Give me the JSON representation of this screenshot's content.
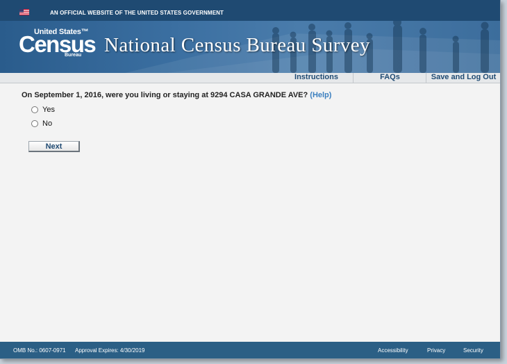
{
  "gov_banner": {
    "text": "AN OFFICIAL WEBSITE OF THE UNITED STATES GOVERNMENT"
  },
  "logo": {
    "line1": "United States™",
    "line2": "Census",
    "line3": "Bureau"
  },
  "site_title": "National Census Bureau Survey",
  "nav": {
    "instructions": "Instructions",
    "faqs": "FAQs",
    "logout": "Save and Log Out"
  },
  "question": {
    "text": "On September 1, 2016, were you living or staying at 9294 CASA GRANDE AVE?",
    "help": "(Help)"
  },
  "options": [
    "Yes",
    "No"
  ],
  "next_button": "Next",
  "footer": {
    "omb": "OMB No.: 0607-0971",
    "approval": "Approval Expires: 4/30/2019",
    "links": [
      "Accessibility",
      "Privacy",
      "Security"
    ]
  },
  "colors": {
    "banner": "#1f4a72",
    "masthead": "#3b6fa1",
    "link": "#3b7fbf",
    "footer": "#2b5f85"
  }
}
